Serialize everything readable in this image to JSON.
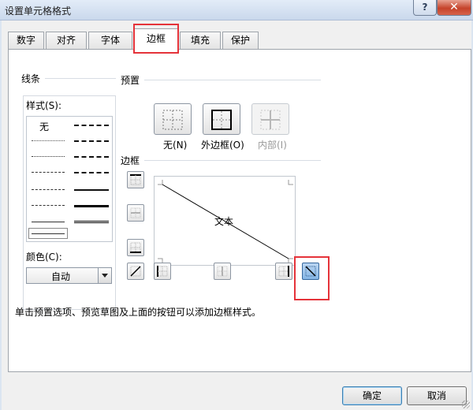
{
  "window": {
    "title": "设置单元格格式",
    "help_label": "?",
    "close_label": "✕"
  },
  "tabs": [
    {
      "label": "数字"
    },
    {
      "label": "对齐"
    },
    {
      "label": "字体"
    },
    {
      "label": "边框",
      "active": true
    },
    {
      "label": "填充"
    },
    {
      "label": "保护"
    }
  ],
  "line_section": {
    "title": "线条",
    "style_label": "样式(S):",
    "none_label": "无",
    "color_label": "颜色(C):",
    "color_value": "自动"
  },
  "presets": {
    "title": "预置",
    "none_label": "无(N)",
    "outline_label": "外边框(O)",
    "inside_label": "内部(I)"
  },
  "border": {
    "title": "边框",
    "preview_text": "文本"
  },
  "hint": "单击预置选项、预览草图及上面的按钮可以添加边框样式。",
  "buttons": {
    "ok_label": "确定",
    "cancel_label": "取消"
  },
  "colors": {
    "highlight": "#e5333a",
    "window_bg": "#dbe5f1",
    "active_border_button": "#86b6e6"
  }
}
